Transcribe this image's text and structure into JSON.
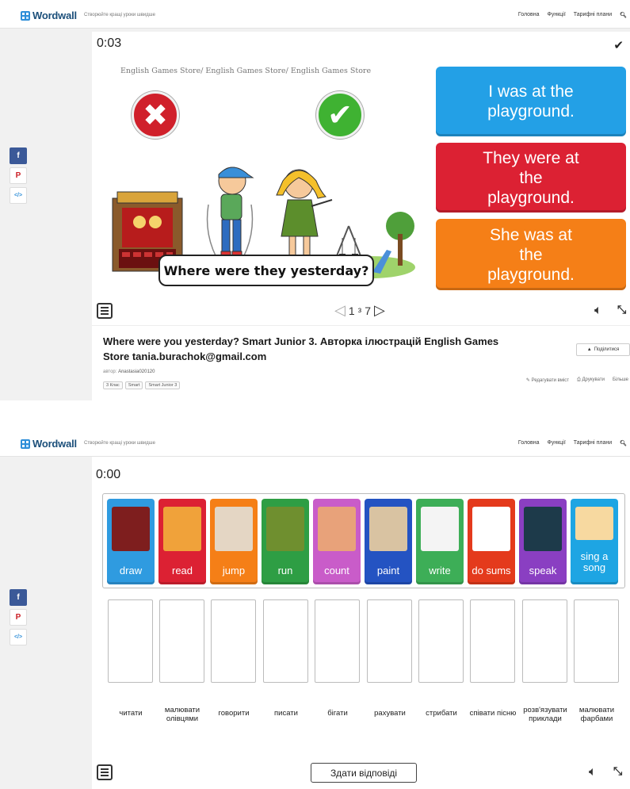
{
  "header": {
    "logo": "Wordwall",
    "tagline": "Створюйте кращі уроки швидше",
    "nav": [
      "Головна",
      "Функції",
      "Тарифні плани"
    ],
    "search_icon": "search-icon"
  },
  "social": {
    "facebook": "f",
    "pinterest": "P",
    "embed": "</>"
  },
  "game1": {
    "timer": "0:03",
    "watermark": "English Games Store/ English Games Store/ English Games Store",
    "question": "Where were they yesterday?",
    "answers": [
      {
        "text": "I was at the playground.",
        "color": "#23a0e6"
      },
      {
        "text": "They were at the playground.",
        "color": "#dc2133"
      },
      {
        "text": "She was at the playground.",
        "color": "#f57f17"
      }
    ],
    "page_current": "1",
    "page_of": "з",
    "page_total": "7"
  },
  "activity": {
    "title": "Where were you yesterday? Smart Junior 3. Авторка ілюстрацій English Games Store tania.burachok@gmail.com",
    "author_label": "автор:",
    "author_name": "Anastasia020120",
    "tags": [
      "3 Клас",
      "Smart",
      "Smart Junior 3"
    ],
    "share": "Поділитися",
    "actions": [
      "Редагувати вміст",
      "Друкувати",
      "Більше"
    ]
  },
  "game2": {
    "timer": "0:00",
    "cards": [
      {
        "label": "draw",
        "color": "#2f9be0"
      },
      {
        "label": "read",
        "color": "#dc2133"
      },
      {
        "label": "jump",
        "color": "#f57f17"
      },
      {
        "label": "run",
        "color": "#2e9e44"
      },
      {
        "label": "count",
        "color": "#c95cc9"
      },
      {
        "label": "paint",
        "color": "#2453c2"
      },
      {
        "label": "write",
        "color": "#3dae57"
      },
      {
        "label": "do sums",
        "color": "#e43a1c"
      },
      {
        "label": "speak",
        "color": "#8a3fc2"
      },
      {
        "label": "sing a song",
        "color": "#1ea5e3"
      }
    ],
    "targets": [
      "читати",
      "малювати олівцями",
      "говорити",
      "писати",
      "бігати",
      "рахувати",
      "стрибати",
      "співати пісню",
      "розв'язувати приклади",
      "малювати фарбами"
    ],
    "submit": "Здати відповіді"
  }
}
